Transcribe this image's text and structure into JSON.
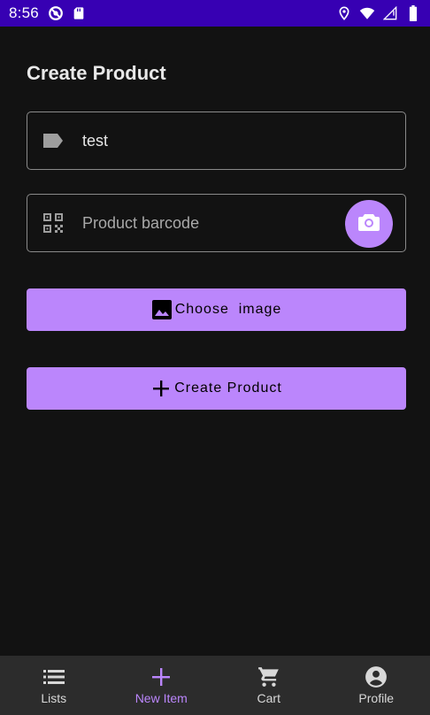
{
  "status_bar": {
    "time": "8:56",
    "background": "#3700b3",
    "left_icons": [
      "no-disturb-icon",
      "sd-card-icon"
    ],
    "right_icons": [
      "location-icon",
      "wifi-icon",
      "signal-icon",
      "battery-icon"
    ]
  },
  "page": {
    "title": "Create Product"
  },
  "form": {
    "name_field": {
      "icon": "label-tag-icon",
      "value": "test"
    },
    "barcode_field": {
      "icon": "qr-code-icon",
      "placeholder": "Product barcode",
      "action_icon": "camera-icon"
    }
  },
  "buttons": {
    "choose_image": {
      "icon": "image-icon",
      "label": "Choose  image"
    },
    "create_product": {
      "icon": "plus-icon",
      "label": "Create Product"
    }
  },
  "bottom_nav": {
    "items": [
      {
        "label": "Lists",
        "icon": "list-icon",
        "active": false
      },
      {
        "label": "New Item",
        "icon": "plus-icon",
        "active": true
      },
      {
        "label": "Cart",
        "icon": "cart-icon",
        "active": false
      },
      {
        "label": "Profile",
        "icon": "account-circle-icon",
        "active": false
      }
    ]
  },
  "colors": {
    "accent": "#bb86fc",
    "background": "#121212",
    "nav_background": "#2c2c2c"
  }
}
